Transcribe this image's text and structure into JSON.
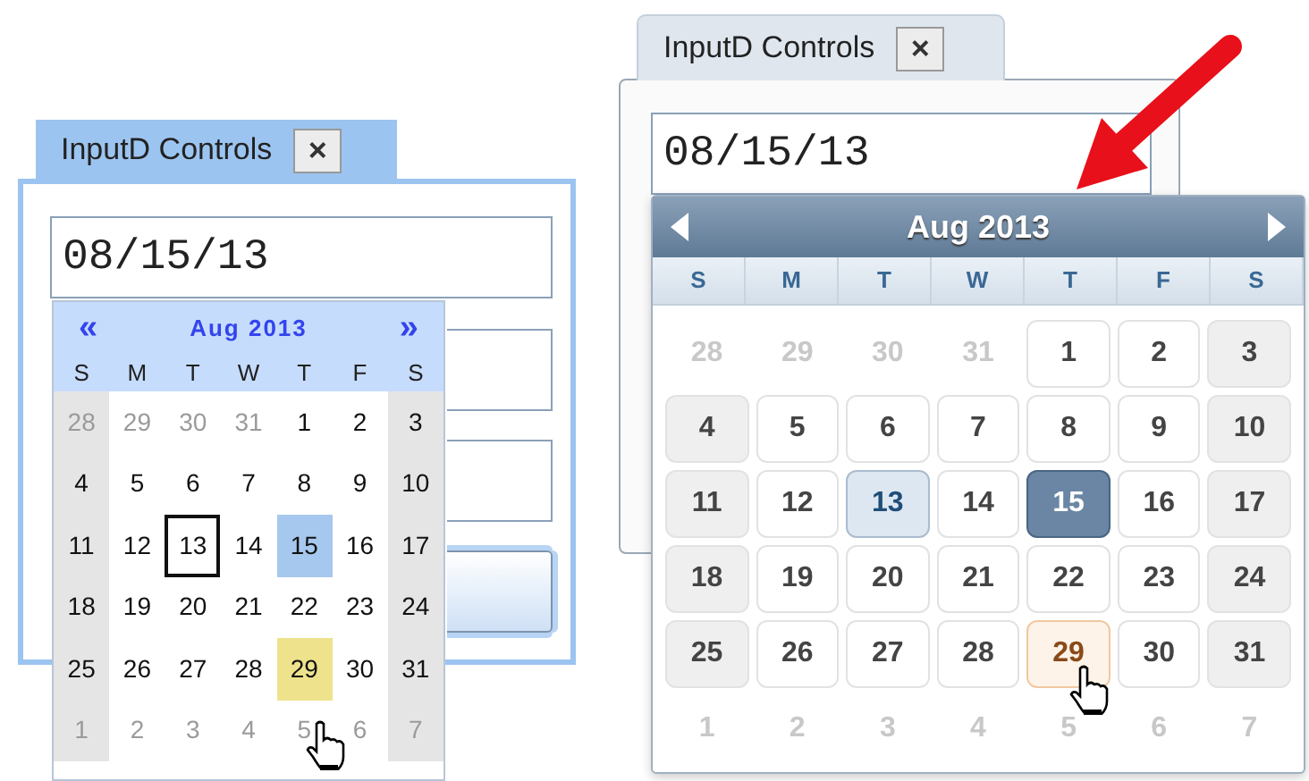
{
  "widgets": [
    {
      "kind": "classic",
      "tab": {
        "title": "InputD Controls",
        "close": "×"
      },
      "field": {
        "value": "08/15/13"
      },
      "covered_controls": [
        {
          "kind": "field"
        },
        {
          "kind": "field"
        },
        {
          "kind": "button"
        }
      ],
      "calendar": {
        "prev": "«",
        "month": "Aug 2013",
        "next": "»",
        "weekdays": [
          "S",
          "M",
          "T",
          "W",
          "T",
          "F",
          "S"
        ],
        "weeks": [
          [
            {
              "text": "28",
              "kind": "outside",
              "selected": false
            },
            {
              "text": "29",
              "kind": "outside",
              "selected": false
            },
            {
              "text": "30",
              "kind": "outside",
              "selected": false
            },
            {
              "text": "31",
              "kind": "outside",
              "selected": false
            },
            {
              "text": "1",
              "kind": "day",
              "selected": false
            },
            {
              "text": "2",
              "kind": "day",
              "selected": false
            },
            {
              "text": "3",
              "kind": "day",
              "selected": false
            }
          ],
          [
            {
              "text": "4",
              "kind": "day",
              "selected": false
            },
            {
              "text": "5",
              "kind": "day",
              "selected": false
            },
            {
              "text": "6",
              "kind": "day",
              "selected": false
            },
            {
              "text": "7",
              "kind": "day",
              "selected": false
            },
            {
              "text": "8",
              "kind": "day",
              "selected": false
            },
            {
              "text": "9",
              "kind": "day",
              "selected": false
            },
            {
              "text": "10",
              "kind": "day",
              "selected": false
            }
          ],
          [
            {
              "text": "11",
              "kind": "day",
              "selected": false
            },
            {
              "text": "12",
              "kind": "day",
              "selected": false
            },
            {
              "text": "13",
              "kind": "today",
              "selected": false
            },
            {
              "text": "14",
              "kind": "day",
              "selected": false
            },
            {
              "text": "15",
              "kind": "day",
              "selected": true
            },
            {
              "text": "16",
              "kind": "day",
              "selected": false
            },
            {
              "text": "17",
              "kind": "day",
              "selected": false
            }
          ],
          [
            {
              "text": "18",
              "kind": "day",
              "selected": false
            },
            {
              "text": "19",
              "kind": "day",
              "selected": false
            },
            {
              "text": "20",
              "kind": "day",
              "selected": false
            },
            {
              "text": "21",
              "kind": "day",
              "selected": false
            },
            {
              "text": "22",
              "kind": "day",
              "selected": false
            },
            {
              "text": "23",
              "kind": "day",
              "selected": false
            },
            {
              "text": "24",
              "kind": "day",
              "selected": false
            }
          ],
          [
            {
              "text": "25",
              "kind": "day",
              "selected": false
            },
            {
              "text": "26",
              "kind": "day",
              "selected": false
            },
            {
              "text": "27",
              "kind": "day",
              "selected": false
            },
            {
              "text": "28",
              "kind": "day",
              "selected": false
            },
            {
              "text": "29",
              "kind": "hover",
              "selected": false
            },
            {
              "text": "30",
              "kind": "day",
              "selected": false
            },
            {
              "text": "31",
              "kind": "day",
              "selected": false
            }
          ],
          [
            {
              "text": "1",
              "kind": "outside",
              "selected": false
            },
            {
              "text": "2",
              "kind": "outside",
              "selected": false
            },
            {
              "text": "3",
              "kind": "outside",
              "selected": false
            },
            {
              "text": "4",
              "kind": "outside",
              "selected": false
            },
            {
              "text": "5",
              "kind": "outside",
              "selected": false
            },
            {
              "text": "6",
              "kind": "outside",
              "selected": false
            },
            {
              "text": "7",
              "kind": "outside",
              "selected": false
            }
          ]
        ]
      }
    },
    {
      "kind": "slate",
      "tab": {
        "title": "InputD Controls",
        "close": "×"
      },
      "field": {
        "value": "08/15/13"
      },
      "calendar": {
        "month": "Aug 2013",
        "weekdays": [
          "S",
          "M",
          "T",
          "W",
          "T",
          "F",
          "S"
        ],
        "weeks": [
          [
            {
              "text": "28",
              "kind": "outside",
              "selected": false
            },
            {
              "text": "29",
              "kind": "outside",
              "selected": false
            },
            {
              "text": "30",
              "kind": "outside",
              "selected": false
            },
            {
              "text": "31",
              "kind": "outside",
              "selected": false
            },
            {
              "text": "1",
              "kind": "day",
              "selected": false
            },
            {
              "text": "2",
              "kind": "day",
              "selected": false
            },
            {
              "text": "3",
              "kind": "day",
              "selected": false
            }
          ],
          [
            {
              "text": "4",
              "kind": "day",
              "selected": false
            },
            {
              "text": "5",
              "kind": "day",
              "selected": false
            },
            {
              "text": "6",
              "kind": "day",
              "selected": false
            },
            {
              "text": "7",
              "kind": "day",
              "selected": false
            },
            {
              "text": "8",
              "kind": "day",
              "selected": false
            },
            {
              "text": "9",
              "kind": "day",
              "selected": false
            },
            {
              "text": "10",
              "kind": "day",
              "selected": false
            }
          ],
          [
            {
              "text": "11",
              "kind": "day",
              "selected": false
            },
            {
              "text": "12",
              "kind": "day",
              "selected": false
            },
            {
              "text": "13",
              "kind": "today",
              "selected": false
            },
            {
              "text": "14",
              "kind": "day",
              "selected": false
            },
            {
              "text": "15",
              "kind": "day",
              "selected": true
            },
            {
              "text": "16",
              "kind": "day",
              "selected": false
            },
            {
              "text": "17",
              "kind": "day",
              "selected": false
            }
          ],
          [
            {
              "text": "18",
              "kind": "day",
              "selected": false
            },
            {
              "text": "19",
              "kind": "day",
              "selected": false
            },
            {
              "text": "20",
              "kind": "day",
              "selected": false
            },
            {
              "text": "21",
              "kind": "day",
              "selected": false
            },
            {
              "text": "22",
              "kind": "day",
              "selected": false
            },
            {
              "text": "23",
              "kind": "day",
              "selected": false
            },
            {
              "text": "24",
              "kind": "day",
              "selected": false
            }
          ],
          [
            {
              "text": "25",
              "kind": "day",
              "selected": false
            },
            {
              "text": "26",
              "kind": "day",
              "selected": false
            },
            {
              "text": "27",
              "kind": "day",
              "selected": false
            },
            {
              "text": "28",
              "kind": "day",
              "selected": false
            },
            {
              "text": "29",
              "kind": "hover",
              "selected": false
            },
            {
              "text": "30",
              "kind": "day",
              "selected": false
            },
            {
              "text": "31",
              "kind": "day",
              "selected": false
            }
          ],
          [
            {
              "text": "1",
              "kind": "outside",
              "selected": false
            },
            {
              "text": "2",
              "kind": "outside",
              "selected": false
            },
            {
              "text": "3",
              "kind": "outside",
              "selected": false
            },
            {
              "text": "4",
              "kind": "outside",
              "selected": false
            },
            {
              "text": "5",
              "kind": "outside",
              "selected": false
            },
            {
              "text": "6",
              "kind": "outside",
              "selected": false
            },
            {
              "text": "7",
              "kind": "outside",
              "selected": false
            }
          ]
        ]
      }
    }
  ]
}
